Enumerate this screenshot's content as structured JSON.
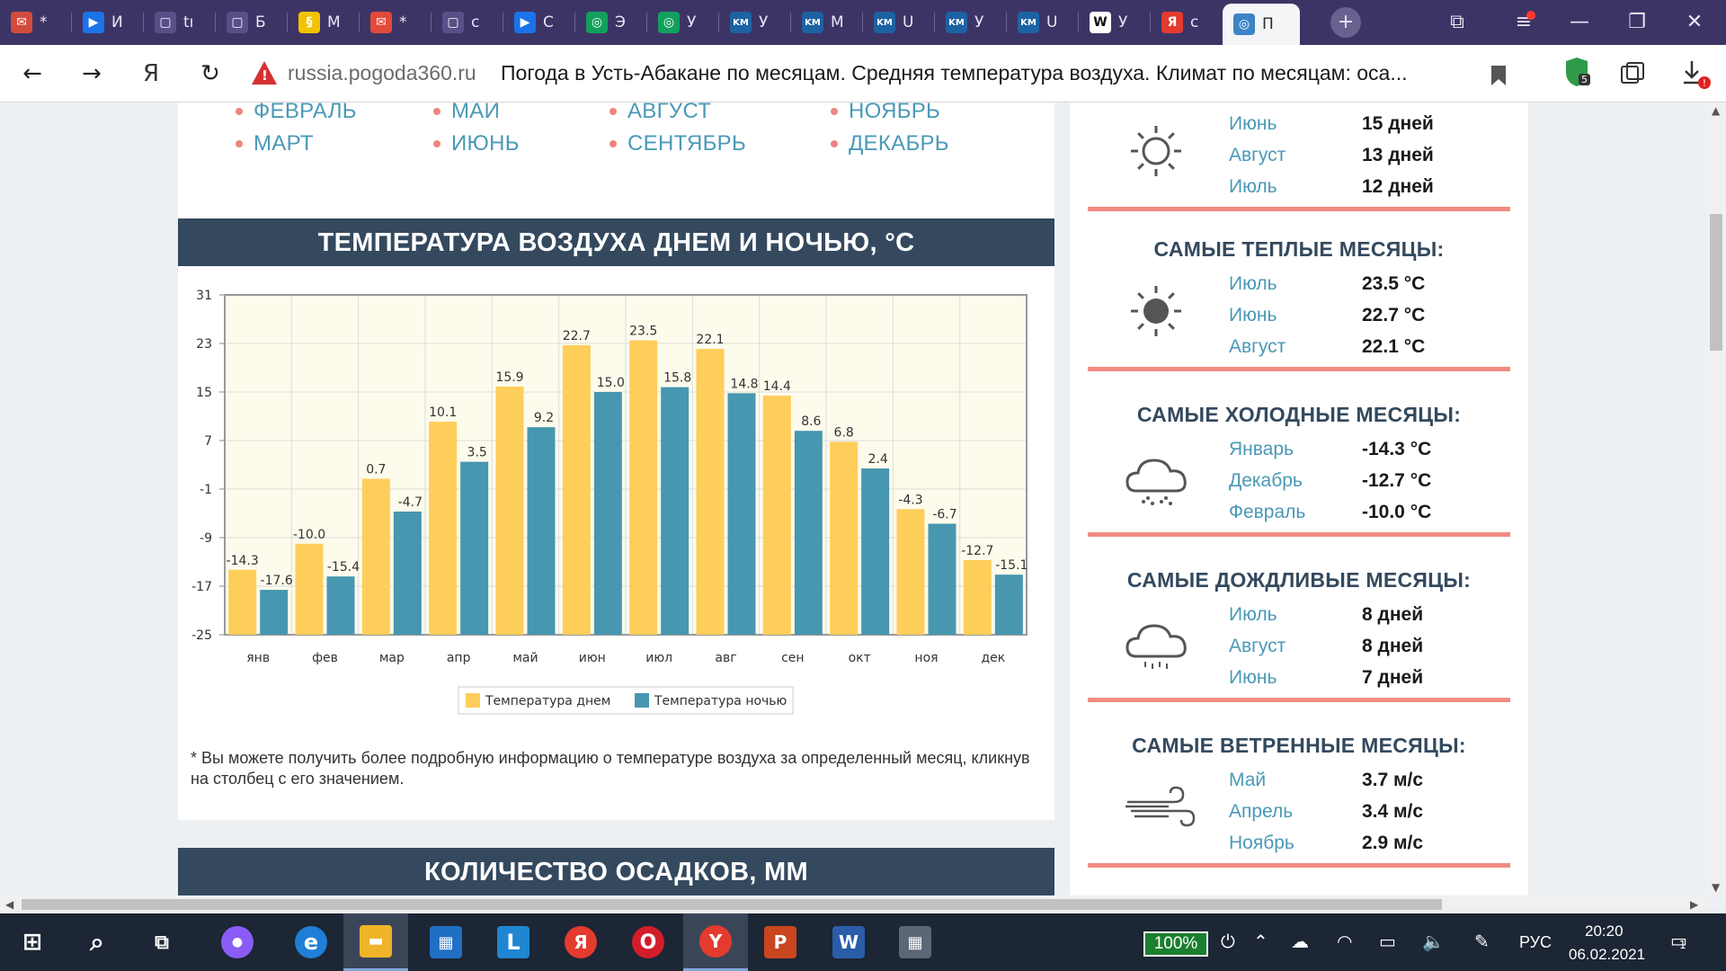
{
  "browser": {
    "tabs": [
      {
        "icon": "gmail-icon",
        "title": "*",
        "color": "#d24c3d",
        "glyph": "✉"
      },
      {
        "icon": "play-icon",
        "title": "И",
        "color": "#1a73e8",
        "glyph": "▶"
      },
      {
        "icon": "doc-icon",
        "title": "tı",
        "color": "#5b4f88",
        "glyph": "▢"
      },
      {
        "icon": "doc-icon",
        "title": "Б",
        "color": "#5b4f88",
        "glyph": "▢"
      },
      {
        "icon": "section-icon",
        "title": "М",
        "color": "#f2c200",
        "glyph": "§"
      },
      {
        "icon": "mail-icon",
        "title": "*",
        "color": "#e24a3a",
        "glyph": "✉"
      },
      {
        "icon": "doc-icon",
        "title": "с",
        "color": "#5b4f88",
        "glyph": "▢"
      },
      {
        "icon": "play-icon",
        "title": "С",
        "color": "#1a73e8",
        "glyph": "▶"
      },
      {
        "icon": "globe-icon",
        "title": "Э",
        "color": "#12a05c",
        "glyph": "◎"
      },
      {
        "icon": "globe-icon",
        "title": "У",
        "color": "#12a05c",
        "glyph": "◎"
      },
      {
        "icon": "km-icon",
        "title": "У",
        "color": "#1d62a3",
        "glyph": "KM"
      },
      {
        "icon": "km-icon",
        "title": "М",
        "color": "#1d62a3",
        "glyph": "KM"
      },
      {
        "icon": "km-icon",
        "title": "U",
        "color": "#1d62a3",
        "glyph": "KM"
      },
      {
        "icon": "km-icon",
        "title": "У",
        "color": "#1d62a3",
        "glyph": "KM"
      },
      {
        "icon": "km-icon",
        "title": "U",
        "color": "#1d62a3",
        "glyph": "KM"
      },
      {
        "icon": "wikipedia-icon",
        "title": "У",
        "color": "#ffffff",
        "glyph": "W"
      },
      {
        "icon": "yandex-icon",
        "title": "с",
        "color": "#e33b2e",
        "glyph": "Я"
      },
      {
        "icon": "globe-icon",
        "title": "П",
        "color": "#3d84c6",
        "glyph": "◎"
      }
    ],
    "domain": "russia.pogoda360.ru",
    "title": "Погода в Усть-Абакане по месяцам. Средняя температура воздуха. Климат по месяцам: оса...",
    "nav_back": "←",
    "nav_forward": "→",
    "nav_reload": "↻",
    "yandex_glyph": "Я",
    "extension_badge": "5"
  },
  "months_list": [
    {
      "label": "ФЕВРАЛЬ"
    },
    {
      "label": "МАЙ"
    },
    {
      "label": "АВГУСТ"
    },
    {
      "label": "НОЯБРЬ"
    },
    {
      "label": "МАРТ"
    },
    {
      "label": "ИЮНЬ"
    },
    {
      "label": "СЕНТЯБРЬ"
    },
    {
      "label": "ДЕКАБРЬ"
    }
  ],
  "temperature_section": {
    "header": "ТЕМПЕРАТУРА ВОЗДУХА ДНЕМ И НОЧЬЮ, °C",
    "note": "* Вы можете получить более подробную информацию о температуре воздуха за определенный месяц, кликнув на столбец с его значением."
  },
  "precipitation_section": {
    "header": "КОЛИЧЕСТВО ОСАДКОВ, ММ"
  },
  "chart_data": {
    "type": "bar",
    "title": "",
    "xlabel": "",
    "ylabel": "",
    "categories": [
      "янв",
      "фев",
      "мар",
      "апр",
      "май",
      "июн",
      "июл",
      "авг",
      "сен",
      "окт",
      "ноя",
      "дек"
    ],
    "series": [
      {
        "name": "Температура днем",
        "color": "#fece5a",
        "values": [
          -14.3,
          -10.0,
          0.7,
          10.1,
          15.9,
          22.7,
          23.5,
          22.1,
          14.4,
          6.8,
          -4.3,
          -12.7
        ]
      },
      {
        "name": "Температура ночью",
        "color": "#4797b0",
        "values": [
          -17.6,
          -15.4,
          -4.7,
          3.5,
          9.2,
          15.0,
          15.8,
          14.8,
          8.6,
          2.4,
          -6.7,
          -15.1
        ]
      }
    ],
    "ylim": [
      -25,
      31
    ],
    "yticks": [
      31,
      23,
      15,
      7,
      -1,
      -9,
      -17,
      -25
    ],
    "grid": true,
    "legend": "bottom-center"
  },
  "stats": [
    {
      "title": "",
      "icon": "sun-icon",
      "rows": [
        {
          "month": "Июнь",
          "value": "15 дней"
        },
        {
          "month": "Август",
          "value": "13 дней"
        },
        {
          "month": "Июль",
          "value": "12 дней"
        }
      ]
    },
    {
      "title": "САМЫЕ ТЕПЛЫЕ МЕСЯЦЫ:",
      "icon": "hot-sun-icon",
      "rows": [
        {
          "month": "Июль",
          "value": "23.5 °C"
        },
        {
          "month": "Июнь",
          "value": "22.7 °C"
        },
        {
          "month": "Август",
          "value": "22.1 °C"
        }
      ]
    },
    {
      "title": "САМЫЕ ХОЛОДНЫЕ МЕСЯЦЫ:",
      "icon": "snow-cloud-icon",
      "rows": [
        {
          "month": "Январь",
          "value": "-14.3 °C"
        },
        {
          "month": "Декабрь",
          "value": "-12.7 °C"
        },
        {
          "month": "Февраль",
          "value": "-10.0 °C"
        }
      ]
    },
    {
      "title": "САМЫЕ ДОЖДЛИВЫЕ МЕСЯЦЫ:",
      "icon": "rain-cloud-icon",
      "rows": [
        {
          "month": "Июль",
          "value": "8 дней"
        },
        {
          "month": "Август",
          "value": "8 дней"
        },
        {
          "month": "Июнь",
          "value": "7 дней"
        }
      ]
    },
    {
      "title": "САМЫЕ ВЕТРЕННЫЕ МЕСЯЦЫ:",
      "icon": "wind-icon",
      "rows": [
        {
          "month": "Май",
          "value": "3.7 м/с"
        },
        {
          "month": "Апрель",
          "value": "3.4 м/с"
        },
        {
          "month": "Ноябрь",
          "value": "2.9 м/с"
        }
      ]
    }
  ],
  "taskbar": {
    "apps": [
      {
        "icon": "windows-start-icon"
      },
      {
        "icon": "search-icon"
      },
      {
        "icon": "task-view-icon"
      },
      {
        "icon": "alice-icon"
      },
      {
        "icon": "edge-icon"
      },
      {
        "icon": "file-explorer-icon"
      },
      {
        "icon": "store-icon"
      },
      {
        "icon": "lingualeo-icon"
      },
      {
        "icon": "yandex-icon"
      },
      {
        "icon": "opera-icon"
      },
      {
        "icon": "yandex-browser-icon"
      },
      {
        "icon": "powerpoint-icon"
      },
      {
        "icon": "word-icon"
      },
      {
        "icon": "calculator-icon"
      }
    ],
    "battery": "100%",
    "language": "РУС",
    "time": "20:20",
    "date": "06.02.2021",
    "notifications": "1"
  }
}
